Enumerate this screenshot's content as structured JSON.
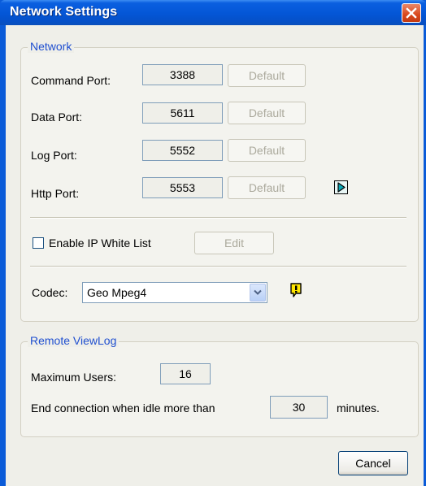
{
  "window": {
    "title": "Network Settings"
  },
  "network": {
    "legend": "Network",
    "ports": [
      {
        "label": "Command Port:",
        "value": "3388",
        "default_label": "Default"
      },
      {
        "label": "Data Port:",
        "value": "5611",
        "default_label": "Default"
      },
      {
        "label": "Log Port:",
        "value": "5552",
        "default_label": "Default"
      },
      {
        "label": "Http Port:",
        "value": "5553",
        "default_label": "Default"
      }
    ],
    "whitelist": {
      "label": "Enable IP White List",
      "checked": false,
      "edit_label": "Edit"
    },
    "codec": {
      "label": "Codec:",
      "value": "Geo Mpeg4"
    }
  },
  "remote": {
    "legend": "Remote ViewLog",
    "max_users_label": "Maximum Users:",
    "max_users_value": "16",
    "idle_label": "End connection when idle more than",
    "idle_value": "30",
    "idle_unit": "minutes."
  },
  "buttons": {
    "cancel": "Cancel"
  },
  "icons": {
    "close": "close-icon",
    "play": "play-icon",
    "warning": "warning-icon"
  },
  "colors": {
    "title_bar": "#0556d6",
    "legend_text": "#1f4fd0",
    "dialog_bg": "#efefe9",
    "close_button": "#d9481c",
    "warning": "#ffe600"
  }
}
